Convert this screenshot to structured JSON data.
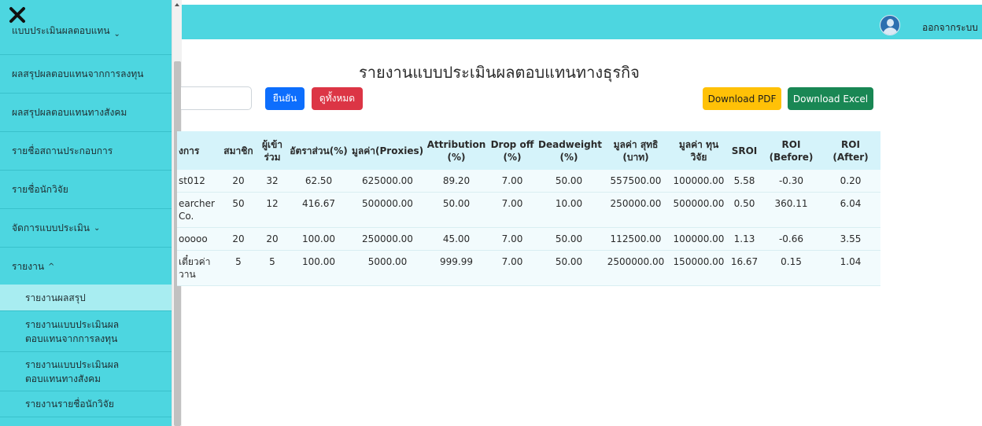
{
  "topbar": {
    "logout_label": "ออกจากระบบ"
  },
  "sidebar": {
    "items": [
      {
        "label": "แบบประเมินผลตอบแทน",
        "chevron": "⌄"
      },
      {
        "label": "ผลสรุปผลตอบแทนจากการลงทุน"
      },
      {
        "label": "ผลสรุปผลตอบแทนทางสังคม"
      },
      {
        "label": "รายชื่อสถานประกอบการ"
      },
      {
        "label": "รายชื่อนักวิจัย"
      },
      {
        "label": "จัดการแบบประเมิน",
        "chevron": "⌄"
      },
      {
        "label": "รายงาน",
        "chevron": "^"
      }
    ],
    "subitems": [
      {
        "label": "รายงานผลสรุป"
      },
      {
        "label": "รายงานแบบประเมินผลตอบแทนจากการลงทุน"
      },
      {
        "label": "รายงานแบบประเมินผลตอบแทนทางสังคม"
      },
      {
        "label": "รายงานรายชื่อนักวิจัย"
      }
    ]
  },
  "main": {
    "title": "รายงานแบบประเมินผลตอบแทนทางธุรกิจ",
    "search": {
      "value": "",
      "placeholder": ""
    },
    "buttons": {
      "confirm": "ยืนยัน",
      "show_all": "ดูทั้งหมด",
      "download_pdf": "Download PDF",
      "download_excel": "Download Excel"
    },
    "table": {
      "headers": [
        "งการ",
        "สมาชิก",
        "ผู้เข้าร่วม",
        "อัตราส่วน(%)",
        "มูลค่า(Proxies)",
        "Attribution (%)",
        "Drop off (%)",
        "Deadweight (%)",
        "มูลค่า สุทธิ (บาท)",
        "มูลค่า ทุนวิจัย",
        "SROI",
        "ROI (Before)",
        "ROI (After)"
      ],
      "rows": [
        [
          "st012",
          "20",
          "32",
          "62.50",
          "625000.00",
          "89.20",
          "7.00",
          "50.00",
          "557500.00",
          "100000.00",
          "5.58",
          "-0.30",
          "0.20"
        ],
        [
          "earcher Co.",
          "50",
          "12",
          "416.67",
          "500000.00",
          "50.00",
          "7.00",
          "10.00",
          "250000.00",
          "500000.00",
          "0.50",
          "360.11",
          "6.04"
        ],
        [
          "ooooo",
          "20",
          "20",
          "100.00",
          "250000.00",
          "45.00",
          "7.00",
          "50.00",
          "112500.00",
          "100000.00",
          "1.13",
          "-0.66",
          "3.55"
        ],
        [
          "เตี๋ยวค่าวาน",
          "5",
          "5",
          "100.00",
          "5000.00",
          "999.99",
          "7.00",
          "50.00",
          "2500000.00",
          "150000.00",
          "16.67",
          "0.15",
          "1.04"
        ]
      ]
    }
  },
  "colors": {
    "accent": "#4dd6e0",
    "confirm": "#0d6efd",
    "show_all": "#dc3545",
    "pdf": "#ffc107",
    "excel": "#198754"
  }
}
